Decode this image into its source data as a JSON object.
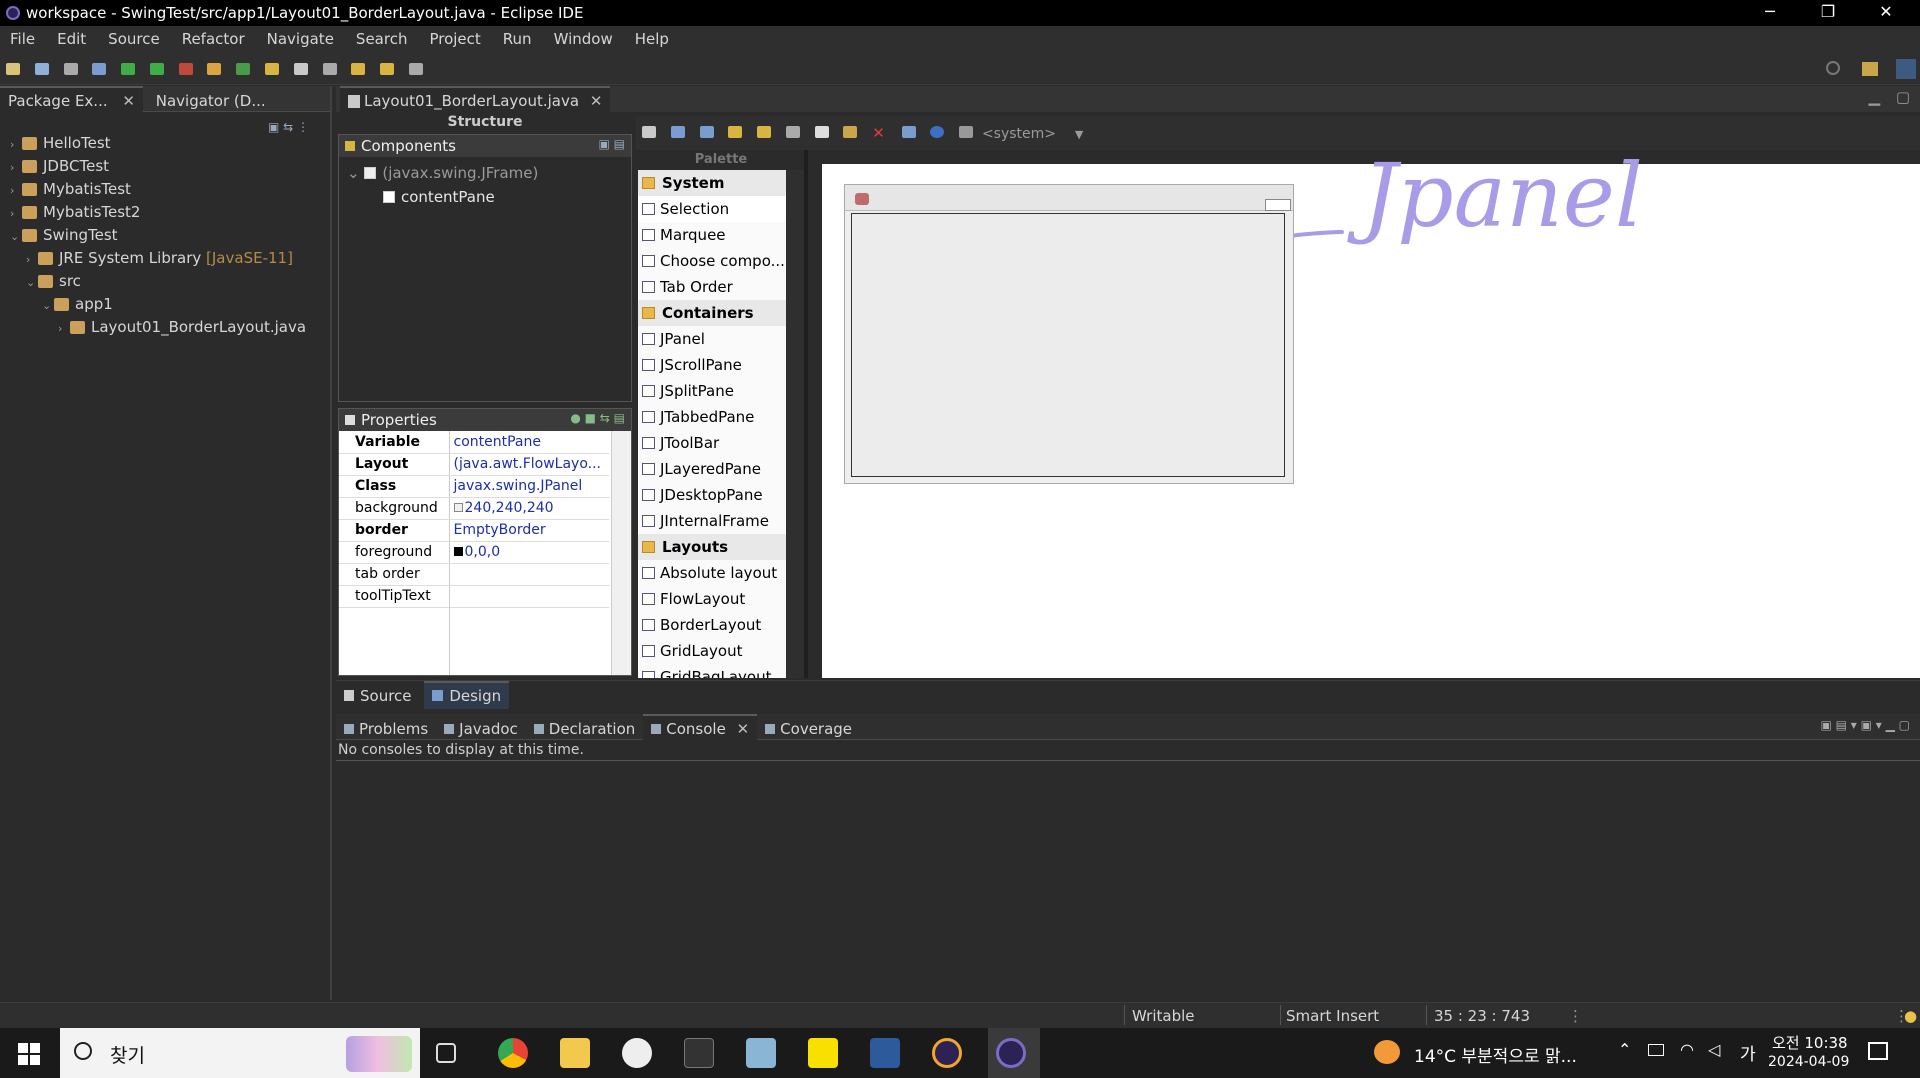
{
  "window": {
    "title": "workspace - SwingTest/src/app1/Layout01_BorderLayout.java - Eclipse IDE",
    "controls": [
      "─",
      "❐",
      "✕"
    ]
  },
  "menu": [
    "File",
    "Edit",
    "Source",
    "Refactor",
    "Navigate",
    "Search",
    "Project",
    "Run",
    "Window",
    "Help"
  ],
  "left_panel": {
    "tabs": [
      "Package Ex...",
      "Navigator (D..."
    ],
    "tree": [
      {
        "label": "HelloTest",
        "indent": 0,
        "arrow": "›"
      },
      {
        "label": "JDBCTest",
        "indent": 0,
        "arrow": "›"
      },
      {
        "label": "MybatisTest",
        "indent": 0,
        "arrow": "›"
      },
      {
        "label": "MybatisTest2",
        "indent": 0,
        "arrow": "›"
      },
      {
        "label": "SwingTest",
        "indent": 0,
        "arrow": "⌄"
      },
      {
        "label": "JRE System Library",
        "suffix": "[JavaSE-11]",
        "indent": 1,
        "arrow": "›"
      },
      {
        "label": "src",
        "indent": 1,
        "arrow": "⌄"
      },
      {
        "label": "app1",
        "indent": 2,
        "arrow": "⌄"
      },
      {
        "label": "Layout01_BorderLayout.java",
        "indent": 3,
        "arrow": "›"
      }
    ]
  },
  "editor": {
    "tab_label": "Layout01_BorderLayout.java",
    "structure_label": "Structure",
    "components_label": "Components",
    "components": [
      "(javax.swing.JFrame)",
      "contentPane"
    ],
    "properties_label": "Properties",
    "properties": [
      {
        "key": "Variable",
        "value": "contentPane",
        "bold": true
      },
      {
        "key": "Layout",
        "value": "(java.awt.FlowLayo...",
        "bold": true
      },
      {
        "key": "Class",
        "value": "javax.swing.JPanel",
        "bold": true
      },
      {
        "key": "background",
        "value": "240,240,240",
        "bold": false
      },
      {
        "key": "border",
        "value": "EmptyBorder",
        "bold": true
      },
      {
        "key": "foreground",
        "value": "0,0,0",
        "bold": false
      },
      {
        "key": "tab order",
        "value": "",
        "bold": false
      },
      {
        "key": "toolTipText",
        "value": "",
        "bold": false
      }
    ],
    "palette_label": "Palette",
    "look_and_feel": "<system>",
    "palette": [
      {
        "label": "System",
        "cat": true
      },
      {
        "label": "Selection",
        "cat": false
      },
      {
        "label": "Marquee",
        "cat": false
      },
      {
        "label": "Choose compo...",
        "cat": false
      },
      {
        "label": "Tab Order",
        "cat": false
      },
      {
        "label": "Containers",
        "cat": true
      },
      {
        "label": "JPanel",
        "cat": false
      },
      {
        "label": "JScrollPane",
        "cat": false
      },
      {
        "label": "JSplitPane",
        "cat": false
      },
      {
        "label": "JTabbedPane",
        "cat": false
      },
      {
        "label": "JToolBar",
        "cat": false
      },
      {
        "label": "JLayeredPane",
        "cat": false
      },
      {
        "label": "JDesktopPane",
        "cat": false
      },
      {
        "label": "JInternalFrame",
        "cat": false
      },
      {
        "label": "Layouts",
        "cat": true
      },
      {
        "label": "Absolute layout",
        "cat": false
      },
      {
        "label": "FlowLayout",
        "cat": false
      },
      {
        "label": "BorderLayout",
        "cat": false
      },
      {
        "label": "GridLayout",
        "cat": false
      },
      {
        "label": "GridBagLayout",
        "cat": false
      }
    ],
    "handwriting": "Jpanel",
    "source_tab": "Source",
    "design_tab": "Design"
  },
  "bottom_panel": {
    "tabs": [
      "Problems",
      "Javadoc",
      "Declaration",
      "Console",
      "Coverage"
    ],
    "active_tab": "Console",
    "message": "No consoles to display at this time."
  },
  "status": {
    "writable": "Writable",
    "insert_mode": "Smart Insert",
    "position": "35 : 23 : 743"
  },
  "taskbar": {
    "search": "찾기",
    "weather": "14°C  부분적으로 맑...",
    "ime": "가",
    "time": "오전 10:38",
    "date": "2024-04-09"
  },
  "colors": {
    "accent_blue": "#1c2fa8",
    "handwriting": "#a99be8"
  }
}
